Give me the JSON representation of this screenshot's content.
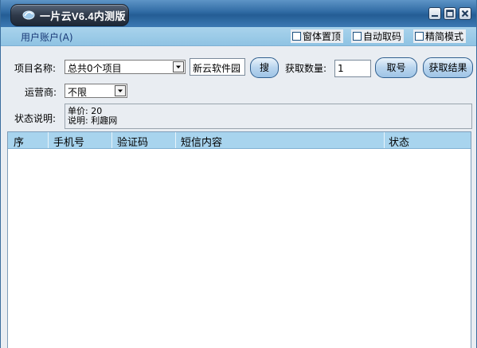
{
  "window": {
    "title": "一片云V6.4内测版"
  },
  "menu": {
    "account": "用户账户(A)"
  },
  "options": [
    {
      "label": "窗体置顶",
      "checked": false
    },
    {
      "label": "自动取码",
      "checked": false
    },
    {
      "label": "精简模式",
      "checked": false
    }
  ],
  "form": {
    "project_label": "项目名称:",
    "project_value": "总共0个项目",
    "search_text": "新云软件园",
    "search_button": "搜",
    "quantity_label": "获取数量:",
    "quantity_value": "1",
    "get_number_button": "取号",
    "get_result_button": "获取结果",
    "carrier_label": "运营商:",
    "carrier_value": "不限",
    "status_label": "状态说明:",
    "status_line1": "单价: 20",
    "status_line2": "说明: 利趣网"
  },
  "table": {
    "columns": [
      "序",
      "手机号",
      "验证码",
      "短信内容",
      "状态"
    ],
    "rows": []
  },
  "colors": {
    "titlebar": "#2f6aa3",
    "strip": "#a9d3ec",
    "header": "#a8d4ee"
  }
}
